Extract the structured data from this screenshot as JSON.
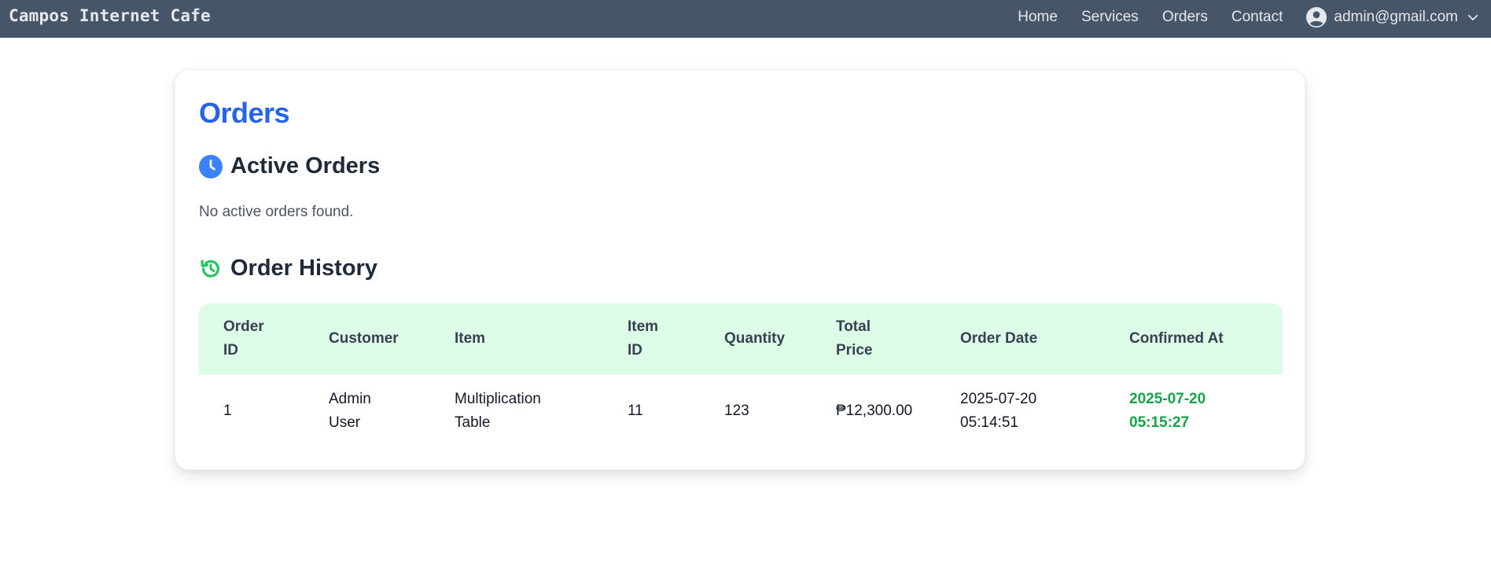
{
  "navbar": {
    "brand": "Campos Internet Cafe",
    "links": [
      "Home",
      "Services",
      "Orders",
      "Contact"
    ],
    "user_email": "admin@gmail.com"
  },
  "page": {
    "title": "Orders"
  },
  "active_orders": {
    "heading": "Active Orders",
    "empty_message": "No active orders found."
  },
  "order_history": {
    "heading": "Order History",
    "columns": [
      [
        "Order",
        "ID"
      ],
      [
        "Customer"
      ],
      [
        "Item"
      ],
      [
        "Item",
        "ID"
      ],
      [
        "Quantity"
      ],
      [
        "Total",
        "Price"
      ],
      [
        "Order Date"
      ],
      [
        "Confirmed At"
      ]
    ],
    "rows": [
      {
        "order_id": "1",
        "customer": [
          "Admin",
          "User"
        ],
        "item": [
          "Multiplication",
          "Table"
        ],
        "item_id": "11",
        "quantity": "123",
        "total_price": "₱12,300.00",
        "order_date": [
          "2025-07-20",
          "05:14:51"
        ],
        "confirmed_at": [
          "2025-07-20",
          "05:15:27"
        ]
      }
    ]
  },
  "colors": {
    "navbar_bg": "#475569",
    "title_blue": "#2563eb",
    "header_green_bg": "#dcfce7",
    "confirmed_green": "#16a34a",
    "clock_icon_blue": "#3b82f6",
    "history_icon_green": "#22c55e"
  },
  "icons": {
    "active_orders": "clock-icon",
    "order_history": "history-icon",
    "user": "user-circle-icon",
    "dropdown": "chevron-down-icon"
  }
}
